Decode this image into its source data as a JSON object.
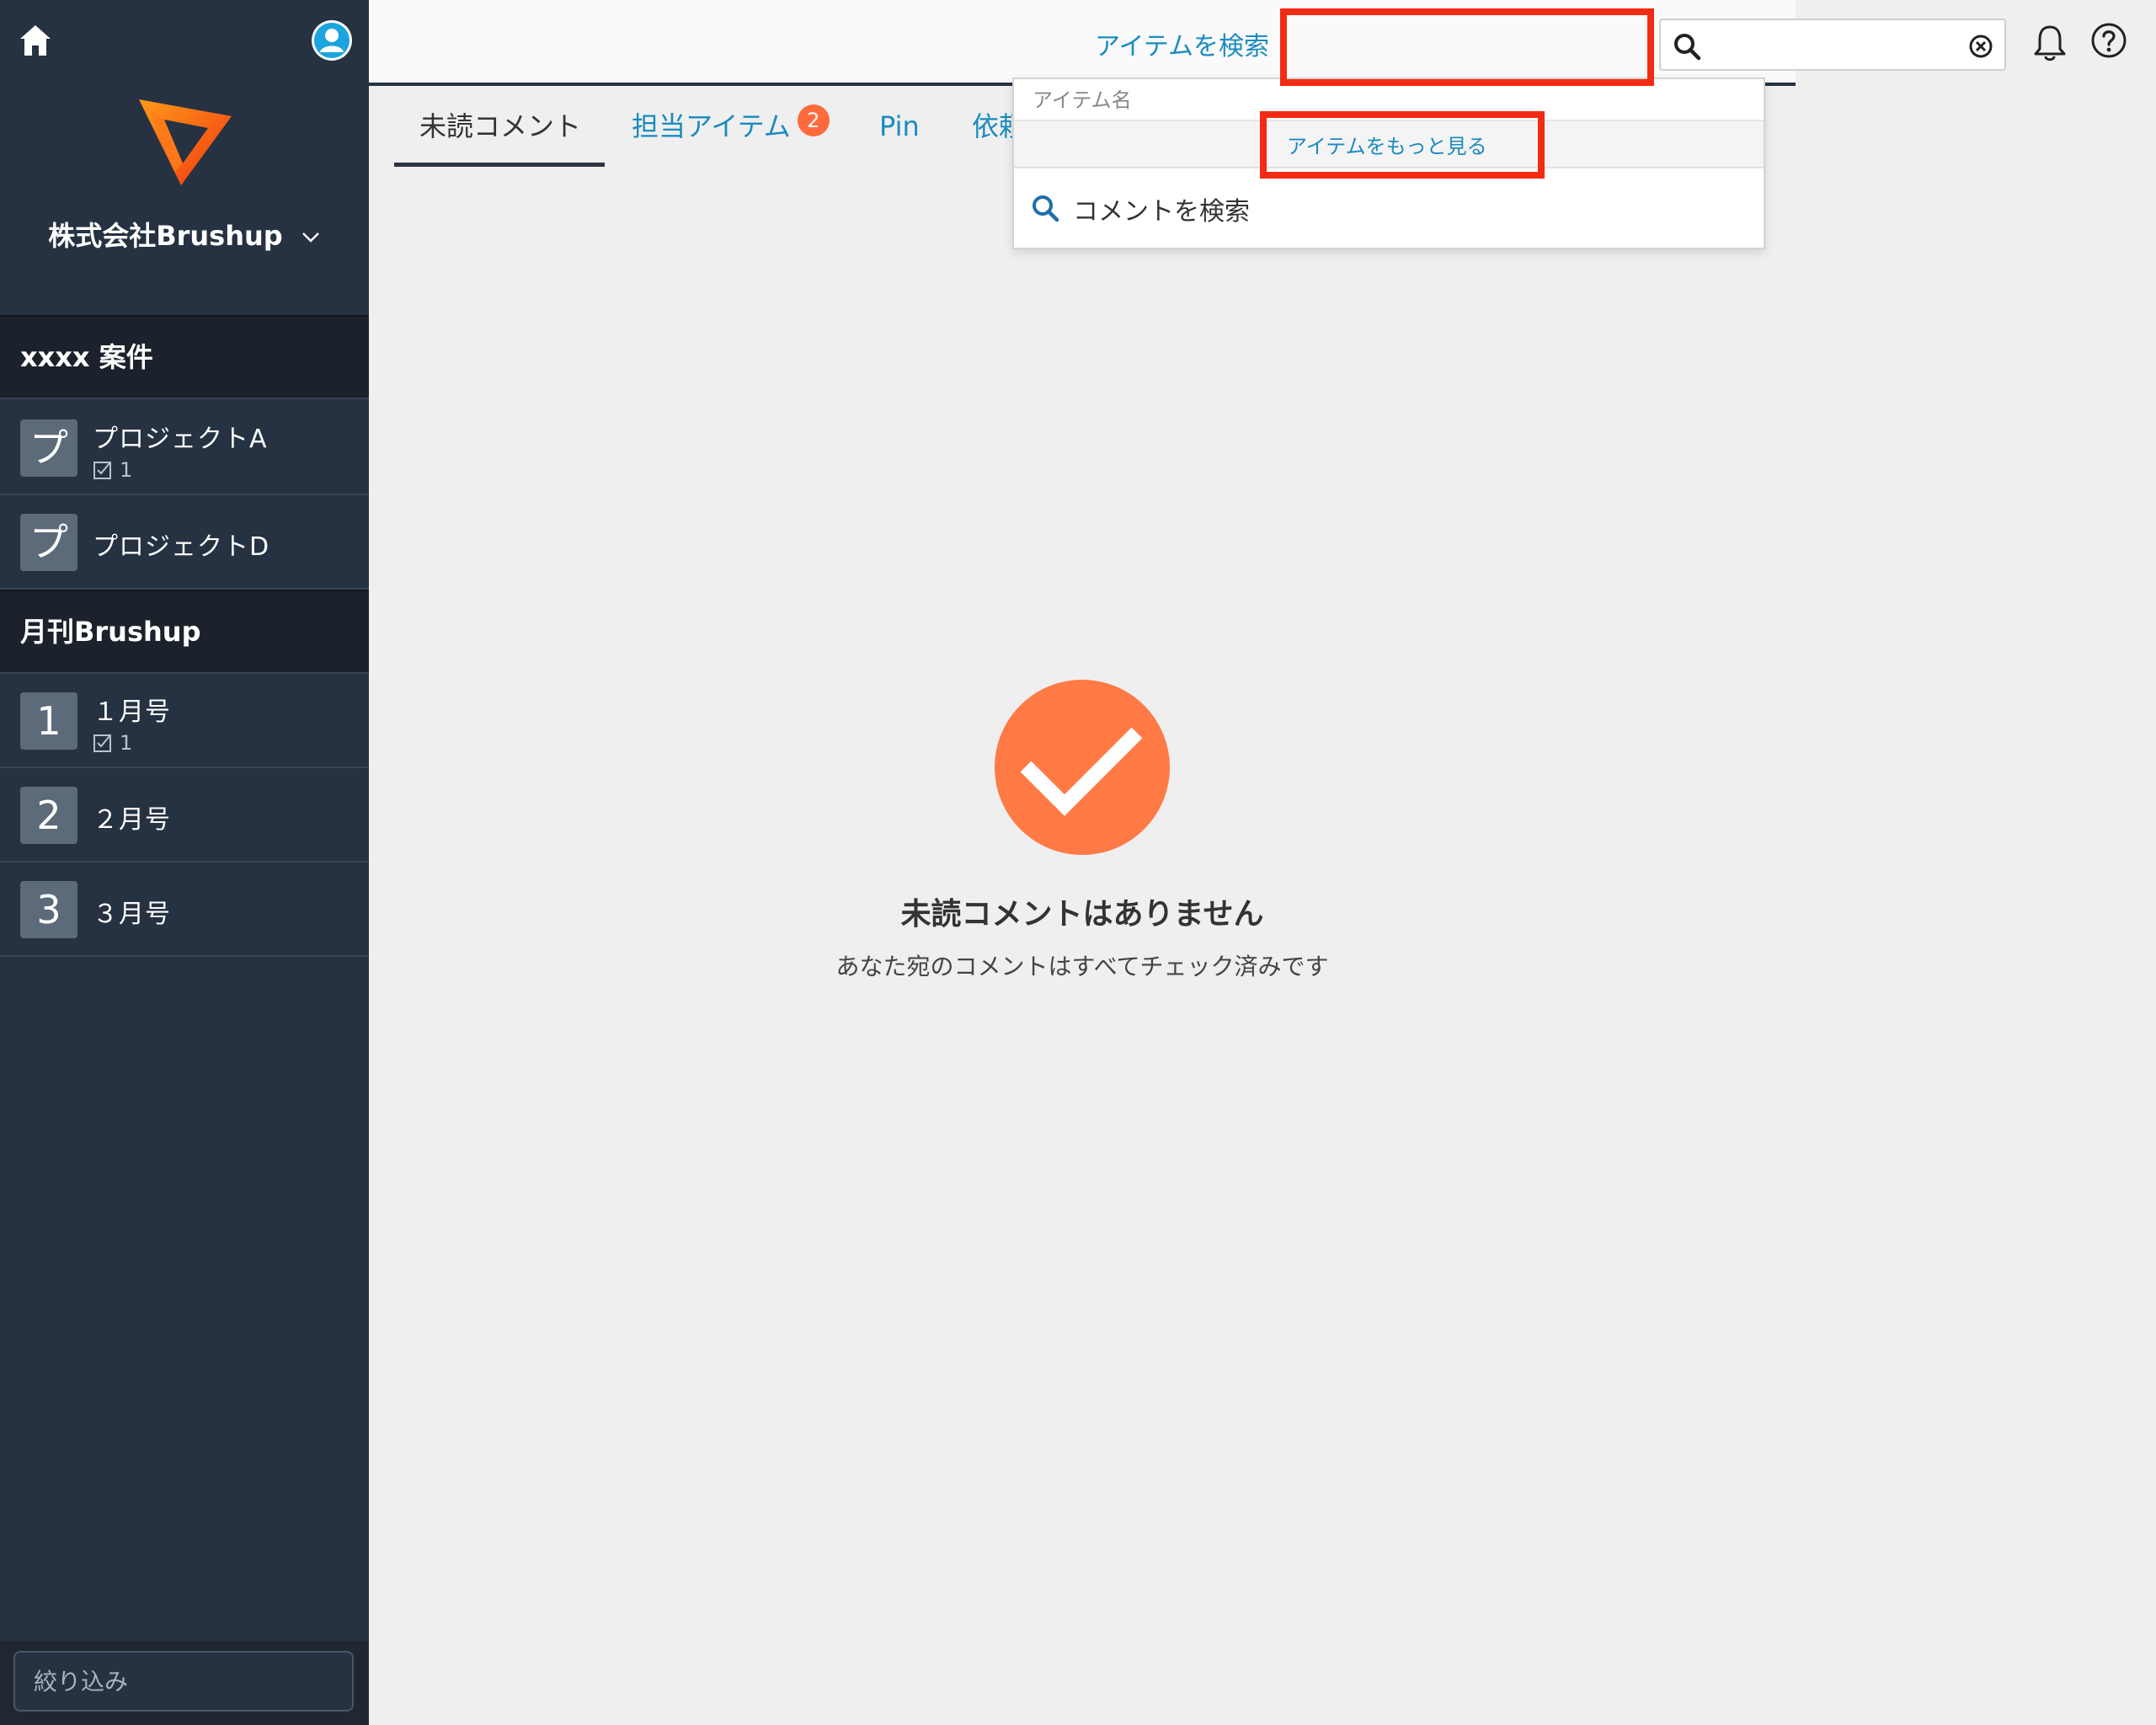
{
  "sidebar": {
    "org_name": "株式会社Brushup",
    "groups": [
      {
        "title": "xxxx 案件",
        "items": [
          {
            "tile": "プ",
            "label": "プロジェクトA",
            "count": "1"
          },
          {
            "tile": "プ",
            "label": "プロジェクトD"
          }
        ]
      },
      {
        "title": "月刊Brushup",
        "items": [
          {
            "tile": "1",
            "label": "１月号",
            "count": "1"
          },
          {
            "tile": "2",
            "label": "２月号"
          },
          {
            "tile": "3",
            "label": "３月号"
          }
        ]
      }
    ],
    "filter_placeholder": "絞り込み"
  },
  "topbar": {
    "search_link": "アイテムを検索",
    "search_value": ""
  },
  "tabs": [
    {
      "label": "未読コメント",
      "active": true
    },
    {
      "label": "担当アイテム",
      "badge": "2"
    },
    {
      "label": "Pin"
    },
    {
      "label": "依頼"
    }
  ],
  "dropdown": {
    "header": "アイテム名",
    "more_link": "アイテムをもっと見る",
    "comment_search": "コメントを検索"
  },
  "empty_state": {
    "title": "未読コメントはありません",
    "subtitle": "あなた宛のコメントはすべてチェック済みです"
  },
  "colors": {
    "sidebar_bg": "#263241",
    "accent_link": "#1a8bbf",
    "badge": "#ff6a3d",
    "highlight": "#f22b12",
    "check": "#ff7a45"
  },
  "icons": [
    "home-icon",
    "user-avatar-icon",
    "brushup-logo",
    "chevron-down-icon",
    "search-icon",
    "clear-icon",
    "bell-icon",
    "help-icon",
    "checklist-icon",
    "checkmark-icon"
  ]
}
